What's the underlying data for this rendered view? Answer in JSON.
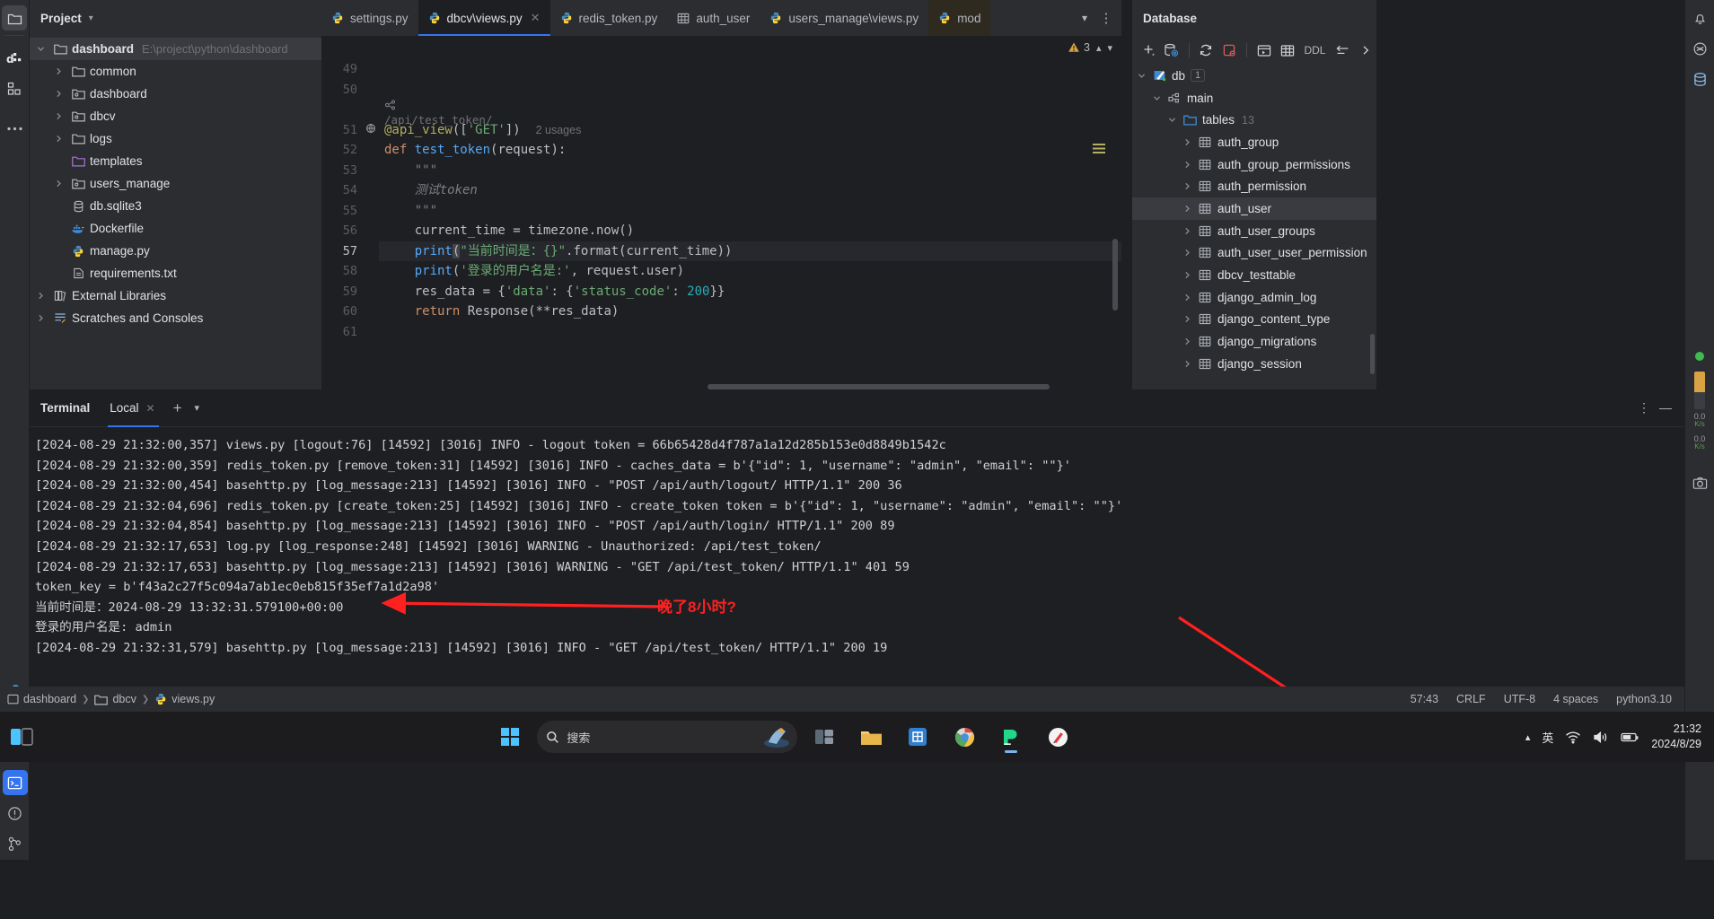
{
  "theme": {
    "bg": "#1e1f22",
    "panel": "#2b2d30",
    "accent": "#3574f0",
    "annotation_red": "#ff2020",
    "string_green": "#6aab73",
    "keyword_orange": "#cf8e6d"
  },
  "left_rail": {
    "icons": [
      {
        "name": "project-folder-icon",
        "glyph": "folder",
        "active": true
      },
      {
        "name": "database-tool-icon",
        "glyph": "di"
      },
      {
        "name": "structure-icon",
        "glyph": "blocks"
      },
      {
        "name": "more-tool-windows-icon",
        "glyph": "dots"
      }
    ],
    "bottom_icons": [
      {
        "name": "python-console-icon",
        "glyph": "python"
      },
      {
        "name": "services-icon",
        "glyph": "layers"
      },
      {
        "name": "run-icon",
        "glyph": "play"
      },
      {
        "name": "terminal-icon",
        "glyph": "terminal",
        "active": true
      },
      {
        "name": "problems-icon",
        "glyph": "warning-circle"
      },
      {
        "name": "version-control-icon",
        "glyph": "git"
      }
    ]
  },
  "project_panel": {
    "title": "Project",
    "tree": [
      {
        "label": "dashboard",
        "path": "E:\\project\\python\\dashboard",
        "icon": "folder-icon",
        "arrow": "expanded",
        "depth": 0,
        "bold": true,
        "selected": true
      },
      {
        "label": "common",
        "icon": "folder-icon",
        "arrow": "collapsed",
        "depth": 1
      },
      {
        "label": "dashboard",
        "icon": "module-folder-icon",
        "arrow": "collapsed",
        "depth": 1
      },
      {
        "label": "dbcv",
        "icon": "module-folder-icon",
        "arrow": "collapsed",
        "depth": 1
      },
      {
        "label": "logs",
        "icon": "folder-icon",
        "arrow": "collapsed",
        "depth": 1
      },
      {
        "label": "templates",
        "icon": "templates-folder-icon",
        "arrow": "none",
        "depth": 1
      },
      {
        "label": "users_manage",
        "icon": "module-folder-icon",
        "arrow": "collapsed",
        "depth": 1
      },
      {
        "label": "db.sqlite3",
        "icon": "database-file-icon",
        "arrow": "none",
        "depth": 1
      },
      {
        "label": "Dockerfile",
        "icon": "docker-icon",
        "arrow": "none",
        "depth": 1
      },
      {
        "label": "manage.py",
        "icon": "python-file-icon",
        "arrow": "none",
        "depth": 1
      },
      {
        "label": "requirements.txt",
        "icon": "text-file-icon",
        "arrow": "none",
        "depth": 1
      },
      {
        "label": "External Libraries",
        "icon": "library-icon",
        "arrow": "collapsed",
        "depth": 0
      },
      {
        "label": "Scratches and Consoles",
        "icon": "scratches-icon",
        "arrow": "collapsed",
        "depth": 0
      }
    ]
  },
  "editor": {
    "tabs": [
      {
        "label": "settings.py",
        "icon": "python-file-icon",
        "active": false,
        "closable": false
      },
      {
        "label": "dbcv\\views.py",
        "icon": "python-file-icon",
        "active": true,
        "closable": true
      },
      {
        "label": "redis_token.py",
        "icon": "python-file-icon",
        "active": false,
        "closable": false
      },
      {
        "label": "auth_user",
        "icon": "table-icon",
        "active": false,
        "closable": false
      },
      {
        "label": "users_manage\\views.py",
        "icon": "python-file-icon",
        "active": false,
        "closable": false
      },
      {
        "label": "mod",
        "icon": "python-file-icon",
        "active": false,
        "closable": false,
        "modified": true
      }
    ],
    "tab_actions": [
      {
        "name": "tab-list-chevron-icon",
        "glyph": "chevron-down"
      },
      {
        "name": "tab-options-icon",
        "glyph": "vertical-dots"
      }
    ],
    "inspection": {
      "warning_icon": "warning-triangle-icon",
      "warning_count": "3",
      "prev_icon": "chevron-up-icon",
      "next_icon": "chevron-down-icon"
    },
    "lines": [
      {
        "num": "49",
        "text": ""
      },
      {
        "num": "50",
        "text": ""
      },
      {
        "num": "",
        "type": "url-lens",
        "text": "/api/test_token/"
      },
      {
        "num": "51",
        "type": "decorator",
        "text": "@api_view(['GET'])",
        "usage": "2 usages",
        "gutter_icon": "web-endpoint-icon"
      },
      {
        "num": "52",
        "type": "def",
        "text": "def test_token(request):"
      },
      {
        "num": "53",
        "type": "doc",
        "text": "    \"\"\""
      },
      {
        "num": "54",
        "type": "doc-zh",
        "text": "    测试token"
      },
      {
        "num": "55",
        "type": "doc",
        "text": "    \"\"\""
      },
      {
        "num": "56",
        "type": "plain",
        "text": "    current_time = timezone.now()"
      },
      {
        "num": "57",
        "type": "print-time",
        "text": "    print(\"当前时间是：{}\".format(current_time))",
        "current": true
      },
      {
        "num": "58",
        "type": "print-user",
        "text": "    print('登录的用户名是:', request.user)"
      },
      {
        "num": "59",
        "type": "resdata",
        "text": "    res_data = {'data': {'status_code': 200}}"
      },
      {
        "num": "60",
        "type": "return",
        "text": "    return Response(**res_data)"
      },
      {
        "num": "61",
        "text": ""
      }
    ]
  },
  "database_panel": {
    "title": "Database",
    "toolbar": [
      {
        "name": "add-new-icon",
        "glyph": "plus"
      },
      {
        "name": "data-source-properties-icon",
        "glyph": "db-gear"
      },
      {
        "name": "refresh-icon",
        "glyph": "refresh"
      },
      {
        "name": "stop-icon",
        "glyph": "stop"
      },
      {
        "name": "open-console-icon",
        "glyph": "console"
      },
      {
        "name": "jump-to-table-icon",
        "glyph": "table"
      },
      {
        "name": "ddl-button",
        "glyph": "text",
        "label": "DDL"
      },
      {
        "name": "sync-icon",
        "glyph": "arrow-in"
      },
      {
        "name": "expand-panel-icon",
        "glyph": "chevron-right"
      }
    ],
    "tree": [
      {
        "label": "db",
        "icon": "sqlite-icon",
        "arrow": "expanded",
        "depth": 0,
        "badge": "1"
      },
      {
        "label": "main",
        "icon": "schema-icon",
        "arrow": "expanded",
        "depth": 1
      },
      {
        "label": "tables",
        "icon": "folder-blue-icon",
        "arrow": "expanded",
        "depth": 2,
        "count": "13"
      },
      {
        "label": "auth_group",
        "icon": "table-icon",
        "arrow": "collapsed",
        "depth": 3
      },
      {
        "label": "auth_group_permissions",
        "icon": "table-icon",
        "arrow": "collapsed",
        "depth": 3
      },
      {
        "label": "auth_permission",
        "icon": "table-icon",
        "arrow": "collapsed",
        "depth": 3
      },
      {
        "label": "auth_user",
        "icon": "table-icon",
        "arrow": "collapsed",
        "depth": 3,
        "selected": true
      },
      {
        "label": "auth_user_groups",
        "icon": "table-icon",
        "arrow": "collapsed",
        "depth": 3
      },
      {
        "label": "auth_user_user_permission",
        "icon": "table-icon",
        "arrow": "collapsed",
        "depth": 3
      },
      {
        "label": "dbcv_testtable",
        "icon": "table-icon",
        "arrow": "collapsed",
        "depth": 3
      },
      {
        "label": "django_admin_log",
        "icon": "table-icon",
        "arrow": "collapsed",
        "depth": 3
      },
      {
        "label": "django_content_type",
        "icon": "table-icon",
        "arrow": "collapsed",
        "depth": 3
      },
      {
        "label": "django_migrations",
        "icon": "table-icon",
        "arrow": "collapsed",
        "depth": 3
      },
      {
        "label": "django_session",
        "icon": "table-icon",
        "arrow": "collapsed",
        "depth": 3
      }
    ]
  },
  "right_rail": {
    "icons": [
      {
        "name": "notifications-icon",
        "glyph": "bell"
      },
      {
        "name": "ai-assistant-icon",
        "glyph": "ai"
      },
      {
        "name": "database-icon",
        "glyph": "database"
      }
    ],
    "status_dot_color": "#3fb950",
    "meters": [
      {
        "value": "0.0",
        "unit": "K/s"
      },
      {
        "value": "0.0",
        "unit": "K/s"
      }
    ],
    "bottom_icons": [
      {
        "name": "screenshot-icon",
        "glyph": "camera"
      }
    ]
  },
  "terminal": {
    "title": "Terminal",
    "tab_label": "Local",
    "tab_close_icon": "close-icon",
    "add_icon": "plus-icon",
    "options_icon": "chevron-down-icon",
    "more_icon": "vertical-dots-icon",
    "minimize_icon": "minimize-icon",
    "lines": [
      "[2024-08-29 21:32:00,357] views.py [logout:76] [14592] [3016] INFO - logout token = 66b65428d4f787a1a12d285b153e0d8849b1542c",
      "[2024-08-29 21:32:00,359] redis_token.py [remove_token:31] [14592] [3016] INFO - caches_data = b'{\"id\": 1, \"username\": \"admin\", \"email\": \"\"}'",
      "[2024-08-29 21:32:00,454] basehttp.py [log_message:213] [14592] [3016] INFO - \"POST /api/auth/logout/ HTTP/1.1\" 200 36",
      "[2024-08-29 21:32:04,696] redis_token.py [create_token:25] [14592] [3016] INFO - create_token token = b'{\"id\": 1, \"username\": \"admin\", \"email\": \"\"}'",
      "[2024-08-29 21:32:04,854] basehttp.py [log_message:213] [14592] [3016] INFO - \"POST /api/auth/login/ HTTP/1.1\" 200 89",
      "[2024-08-29 21:32:17,653] log.py [log_response:248] [14592] [3016] WARNING - Unauthorized: /api/test_token/",
      "[2024-08-29 21:32:17,653] basehttp.py [log_message:213] [14592] [3016] WARNING - \"GET /api/test_token/ HTTP/1.1\" 401 59",
      "token_key = b'f43a2c27f5c094a7ab1ec0eb815f35ef7a1d2a98'",
      "当前时间是：2024-08-29 13:32:31.579100+00:00",
      "登录的用户名是: admin",
      "[2024-08-29 21:32:31,579] basehttp.py [log_message:213] [14592] [3016] INFO - \"GET /api/test_token/ HTTP/1.1\" 200 19"
    ]
  },
  "annotations": {
    "note_text": "晚了8小时?",
    "color": "#ff2020"
  },
  "status_bar": {
    "breadcrumb": [
      {
        "label": "dashboard",
        "icon": "module-icon"
      },
      {
        "label": "dbcv",
        "icon": "folder-icon"
      },
      {
        "label": "views.py",
        "icon": "python-file-icon"
      }
    ],
    "right": [
      {
        "name": "caret-position",
        "label": "57:43"
      },
      {
        "name": "line-separator",
        "label": "CRLF"
      },
      {
        "name": "file-encoding",
        "label": "UTF-8"
      },
      {
        "name": "indent",
        "label": "4 spaces"
      },
      {
        "name": "interpreter",
        "label": "python3.10"
      }
    ]
  },
  "taskbar": {
    "task_view_icon": "task-view-icon",
    "start_icon": "windows-start-icon",
    "search_placeholder": "搜索",
    "search_icon": "search-icon",
    "apps": [
      {
        "name": "taskbar-widgets-app",
        "glyph": "widgets"
      },
      {
        "name": "taskbar-explorer-app",
        "glyph": "folder"
      },
      {
        "name": "taskbar-store-app",
        "glyph": "store"
      },
      {
        "name": "taskbar-chrome-app",
        "glyph": "chrome"
      },
      {
        "name": "taskbar-pycharm-app",
        "glyph": "pycharm",
        "running": true
      },
      {
        "name": "taskbar-paint-app",
        "glyph": "pen"
      }
    ],
    "tray": [
      {
        "name": "tray-expand-icon",
        "glyph": "chevron-up"
      },
      {
        "name": "tray-ime-icon",
        "glyph": "ime",
        "label": "英"
      },
      {
        "name": "tray-wifi-icon",
        "glyph": "wifi"
      },
      {
        "name": "tray-volume-icon",
        "glyph": "volume"
      },
      {
        "name": "tray-battery-icon",
        "glyph": "battery"
      }
    ],
    "clock_time": "21:32",
    "clock_date": "2024/8/29"
  }
}
